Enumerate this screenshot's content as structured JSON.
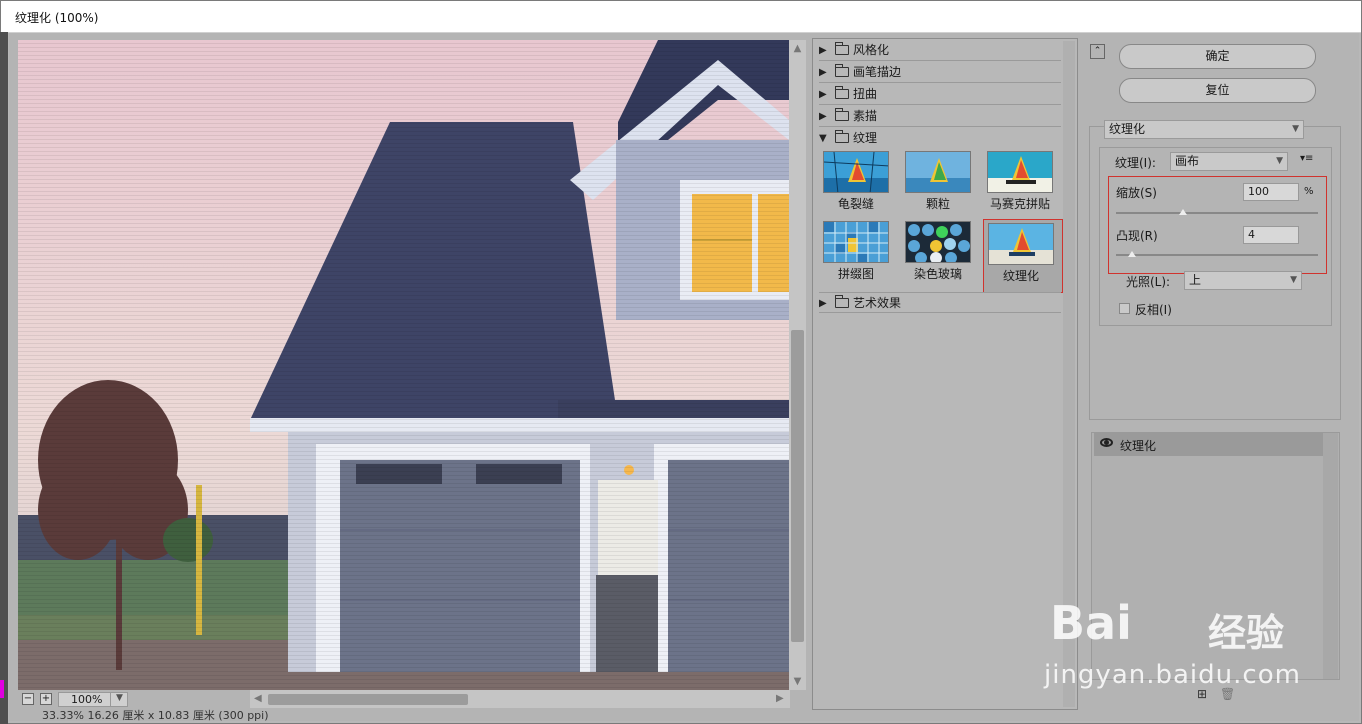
{
  "window": {
    "title": "纹理化 (100%)"
  },
  "preview": {
    "zoom": "100%",
    "zoom_out": "−",
    "zoom_in": "+",
    "status": "33.33%   16.26 厘米 x 10.83 厘米 (300 ppi)"
  },
  "filters": {
    "categories": [
      {
        "label": "风格化",
        "expanded": false
      },
      {
        "label": "画笔描边",
        "expanded": false
      },
      {
        "label": "扭曲",
        "expanded": false
      },
      {
        "label": "素描",
        "expanded": false
      },
      {
        "label": "纹理",
        "expanded": true
      },
      {
        "label": "艺术效果",
        "expanded": false
      }
    ],
    "texture_items": [
      {
        "label": "龟裂缝",
        "selected": false
      },
      {
        "label": "颗粒",
        "selected": false
      },
      {
        "label": "马赛克拼贴",
        "selected": false
      },
      {
        "label": "拼缀图",
        "selected": false
      },
      {
        "label": "染色玻璃",
        "selected": false
      },
      {
        "label": "纹理化",
        "selected": true
      }
    ]
  },
  "buttons": {
    "ok": "确定",
    "reset": "复位"
  },
  "settings": {
    "filter_select": "纹理化",
    "texture_label": "纹理(I):",
    "texture_value": "画布",
    "scale_label": "缩放(S)",
    "scale_value": "100",
    "scale_unit": "%",
    "scale_fraction": 0.33,
    "relief_label": "凸现(R)",
    "relief_value": "4",
    "relief_fraction": 0.08,
    "light_label": "光照(L):",
    "light_value": "上",
    "invert_label": "反相(I)",
    "invert_checked": false
  },
  "layers": {
    "items": [
      {
        "label": "纹理化",
        "visible": true
      }
    ]
  },
  "watermark": {
    "brand": "Bai",
    "brand_cn": "经验",
    "url": "jingyan.baidu.com"
  },
  "colors": {
    "highlight": "#d0332e",
    "sky": "#e9c9d2",
    "roof": "#3e4466",
    "wall": "#a9b0c8",
    "window_light": "#f2b94a"
  }
}
